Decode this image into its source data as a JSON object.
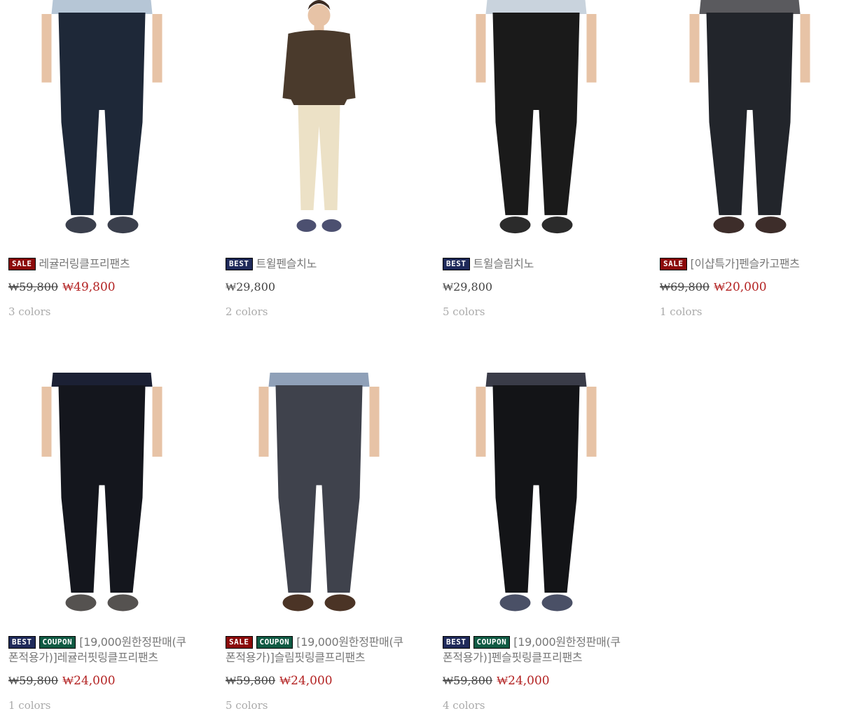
{
  "products": [
    {
      "badges": [
        {
          "type": "sale",
          "label": "SALE"
        }
      ],
      "name": "레귤러링클프리팬츠",
      "old_price": "₩59,800",
      "price": "₩49,800",
      "colors": "3 colors",
      "pants_color": "#1e2838",
      "top_color": "#b6c6d6",
      "shoe_color": "#3a3f4c"
    },
    {
      "badges": [
        {
          "type": "best",
          "label": "BEST"
        }
      ],
      "name": "트윌펜슬치노",
      "old_price": "",
      "price": "₩29,800",
      "colors": "2 colors",
      "pants_color": "#ece1c6",
      "top_color": "#4a3a2c",
      "shoe_color": "#4c5070"
    },
    {
      "badges": [
        {
          "type": "best",
          "label": "BEST"
        }
      ],
      "name": "트윌슬림치노",
      "old_price": "",
      "price": "₩29,800",
      "colors": "5 colors",
      "pants_color": "#1a1a1a",
      "top_color": "#c9d3dd",
      "shoe_color": "#2b2b2b"
    },
    {
      "badges": [
        {
          "type": "sale",
          "label": "SALE"
        }
      ],
      "name": "[이샵특가]펜슬카고팬츠",
      "old_price": "₩69,800",
      "price": "₩20,000",
      "colors": "1 colors",
      "pants_color": "#22252b",
      "top_color": "#5a5a5e",
      "shoe_color": "#3d2d2a"
    },
    {
      "badges": [
        {
          "type": "best",
          "label": "BEST"
        },
        {
          "type": "coupon",
          "label": "COUPON"
        }
      ],
      "name": "[19,000원한정판매(쿠폰적용가)]레귤러핏링클프리팬츠",
      "old_price": "₩59,800",
      "price": "₩24,000",
      "colors": "1 colors",
      "pants_color": "#14161d",
      "top_color": "#1b2034",
      "shoe_color": "#555250"
    },
    {
      "badges": [
        {
          "type": "sale",
          "label": "SALE"
        },
        {
          "type": "coupon",
          "label": "COUPON"
        }
      ],
      "name": "[19,000원한정판매(쿠폰적용가)]슬림핏링클프리팬츠",
      "old_price": "₩59,800",
      "price": "₩24,000",
      "colors": "5 colors",
      "pants_color": "#3f424c",
      "top_color": "#8fa0b8",
      "shoe_color": "#4b3426"
    },
    {
      "badges": [
        {
          "type": "best",
          "label": "BEST"
        },
        {
          "type": "coupon",
          "label": "COUPON"
        }
      ],
      "name": "[19,000원한정판매(쿠폰적용가)]펜슬핏링클프리팬츠",
      "old_price": "₩59,800",
      "price": "₩24,000",
      "colors": "4 colors",
      "pants_color": "#131417",
      "top_color": "#3a3c48",
      "shoe_color": "#4a5066"
    }
  ]
}
